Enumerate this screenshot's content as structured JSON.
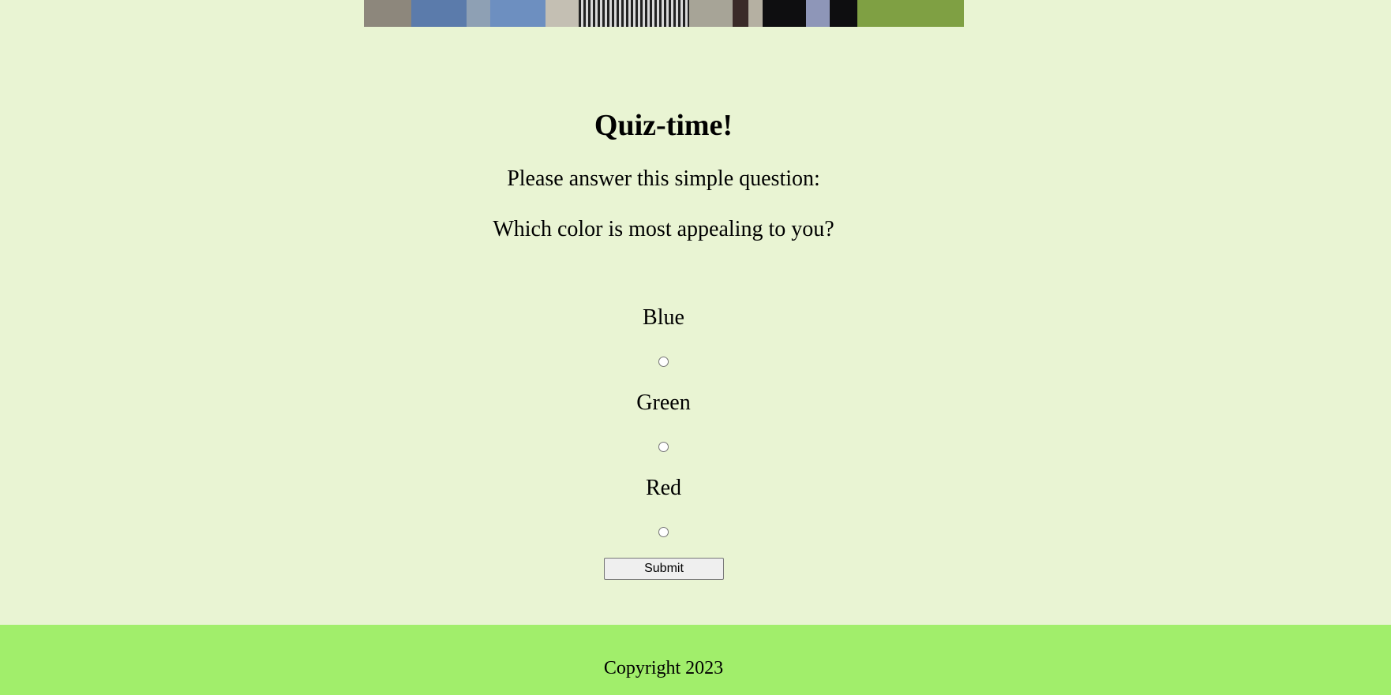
{
  "quiz": {
    "title": "Quiz-time!",
    "prompt": "Please answer this simple question:",
    "question": "Which color is most appealing to you?",
    "options": [
      {
        "label": "Blue"
      },
      {
        "label": "Green"
      },
      {
        "label": "Red"
      }
    ],
    "submit_label": "Submit"
  },
  "footer": {
    "text": "Copyright 2023"
  },
  "colors": {
    "page_background": "#e9f4d3",
    "footer_background": "#a1ee6b"
  }
}
